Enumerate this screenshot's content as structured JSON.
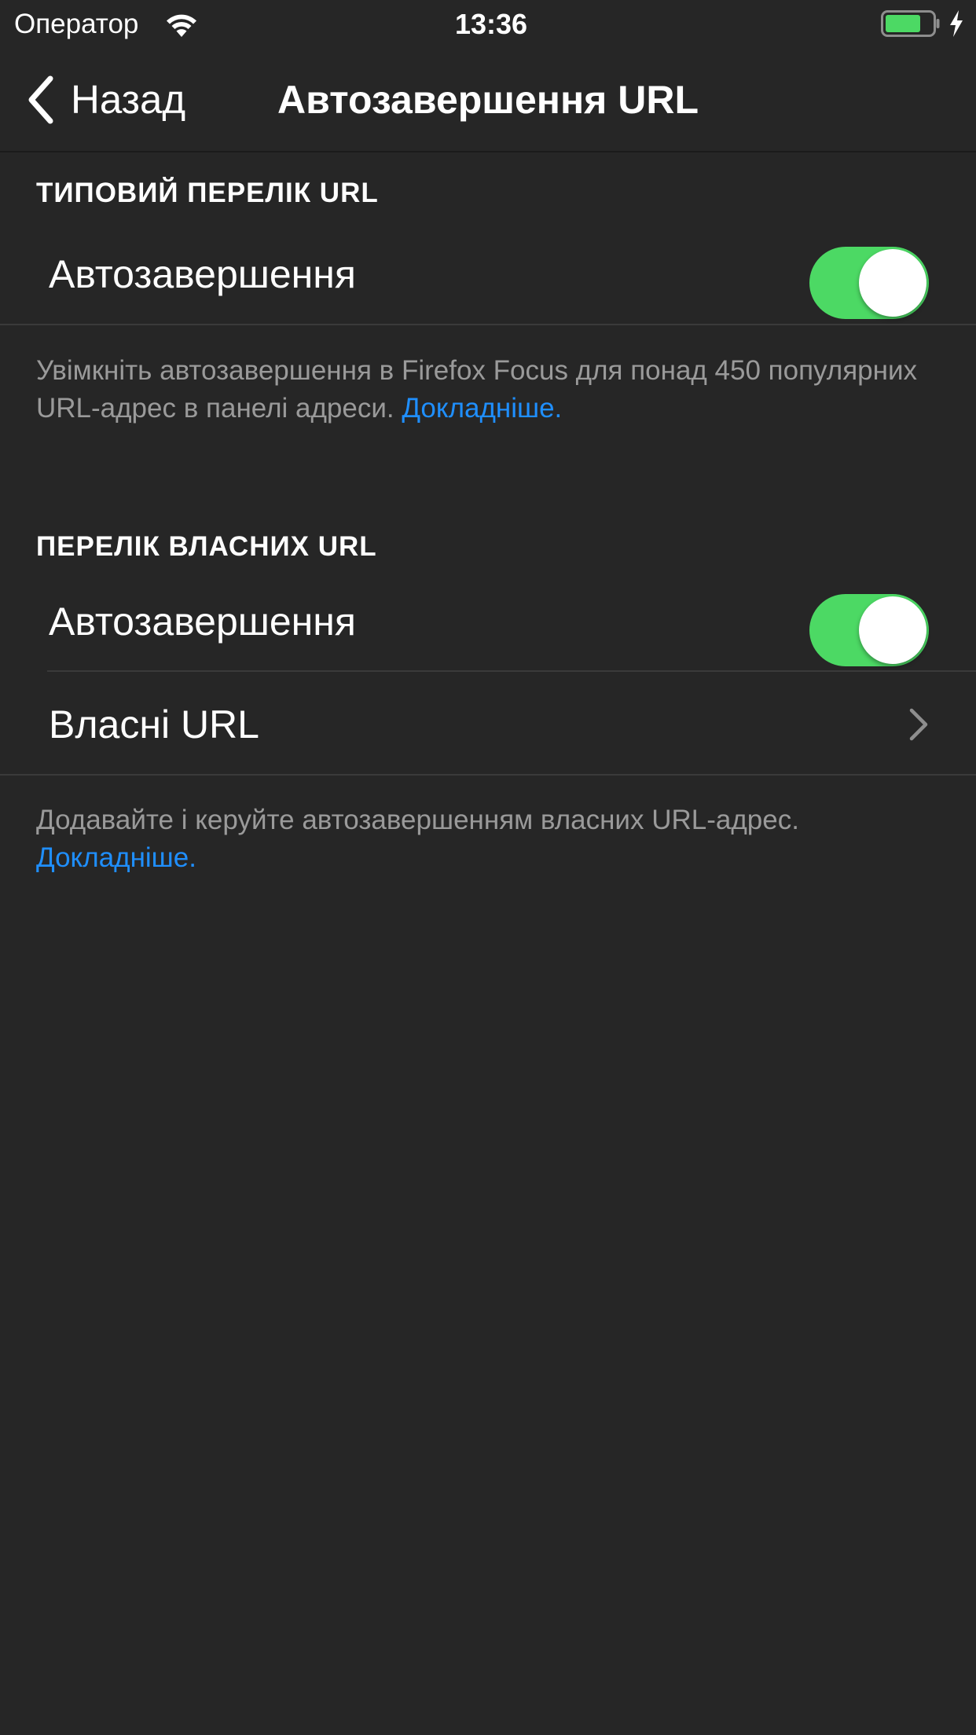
{
  "status_bar": {
    "carrier": "Оператор",
    "time": "13:36",
    "wifi_icon": "wifi-icon",
    "battery_icon": "battery-icon",
    "charging_icon": "charging-icon",
    "battery_color": "#4cd964"
  },
  "nav": {
    "back_label": "Назад",
    "back_icon": "chevron-left-icon",
    "title": "Автозавершення URL"
  },
  "sections": [
    {
      "header": "ТИПОВИЙ ПЕРЕЛІК URL",
      "rows": [
        {
          "label": "Автозавершення",
          "toggle_on": true
        }
      ],
      "footer_text": "Увімкніть автозавершення в Firefox Focus для понад 450 популярних URL-адрес в панелі адреси. ",
      "footer_link": "Докладніше."
    },
    {
      "header": "ПЕРЕЛІК ВЛАСНИХ URL",
      "rows": [
        {
          "label": "Автозавершення",
          "toggle_on": true
        },
        {
          "label": "Власні URL",
          "icon": "chevron-right-icon"
        }
      ],
      "footer_text": "Додавайте і керуйте автозавершенням власних URL-адрес. ",
      "footer_link": "Докладніше."
    }
  ],
  "colors": {
    "background": "#262626",
    "toggle_on": "#4cd964",
    "link": "#1f8fff",
    "footer_text": "#9a9a9a"
  }
}
